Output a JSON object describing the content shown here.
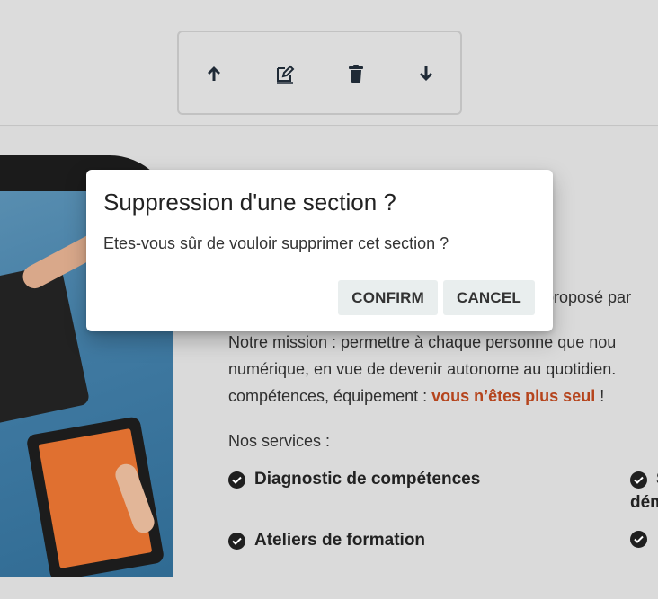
{
  "toolbar": {
    "icons": [
      "arrow-up-icon",
      "edit-icon",
      "trash-icon",
      "arrow-down-icon"
    ]
  },
  "content": {
    "proposed_text": "t proposé par",
    "mission_line1": "Notre mission : permettre à chaque personne que nou",
    "mission_line2": "numérique, en vue de devenir autonome au quotidien.",
    "mission_line3_start": "compétences, équipement : ",
    "mission_highlight": "vous n’êtes plus seul",
    "mission_line3_end": " !",
    "services_heading": "Nos services :",
    "services": [
      "Diagnostic de compétences",
      "Ateliers de formation",
      "S",
      ""
    ],
    "service3_sub": "dém"
  },
  "dialog": {
    "title": "Suppression d'une section ?",
    "message": "Etes-vous sûr de vouloir supprimer cet section ?",
    "confirm_label": "CONFIRM",
    "cancel_label": "CANCEL"
  },
  "colors": {
    "highlight": "#b5441c",
    "dialog_button_bg": "#e9eeee"
  }
}
